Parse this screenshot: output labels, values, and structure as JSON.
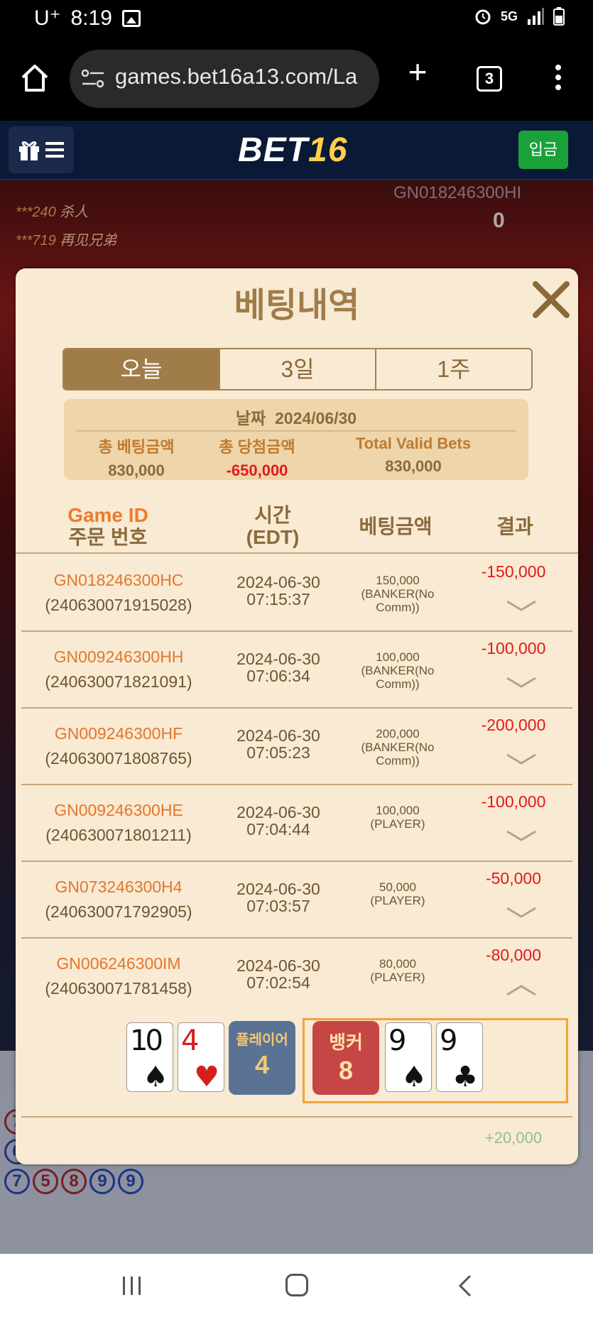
{
  "status_bar": {
    "carrier": "U⁺",
    "time": "8:19",
    "network": "5G"
  },
  "browser": {
    "url": "games.bet16a13.com/La",
    "tab_count": "3"
  },
  "site": {
    "logo_text": "BET",
    "logo_num": "16",
    "deposit_label": "입금"
  },
  "background": {
    "chat": [
      {
        "user": "***240",
        "msg": "杀人"
      },
      {
        "user": "***719",
        "msg": "再见兄弟"
      }
    ],
    "game_id": "GN018246300HI",
    "balance": "0"
  },
  "modal": {
    "title": "베팅내역",
    "tabs": [
      "오늘",
      "3일",
      "1주"
    ],
    "active_tab": 0,
    "summary": {
      "date_label": "날짜",
      "date": "2024/06/30",
      "total_bet_label": "총 베팅금액",
      "total_bet": "830,000",
      "total_win_label": "총 당첨금액",
      "total_win": "-650,000",
      "valid_label": "Total Valid Bets",
      "valid": "830,000"
    },
    "headers": {
      "game_id": "Game ID",
      "order_no": "주문 번호",
      "time": "시간",
      "time_zone": "(EDT)",
      "amount": "베팅금액",
      "result": "결과"
    },
    "rows": [
      {
        "game_id": "GN018246300HC",
        "order_no": "(240630071915028)",
        "date": "2024-06-30",
        "time": "07:15:37",
        "amount": "150,000",
        "bet_type": "(BANKER(No Comm))",
        "result": "-150,000"
      },
      {
        "game_id": "GN009246300HH",
        "order_no": "(240630071821091)",
        "date": "2024-06-30",
        "time": "07:06:34",
        "amount": "100,000",
        "bet_type": "(BANKER(No Comm))",
        "result": "-100,000"
      },
      {
        "game_id": "GN009246300HF",
        "order_no": "(240630071808765)",
        "date": "2024-06-30",
        "time": "07:05:23",
        "amount": "200,000",
        "bet_type": "(BANKER(No Comm))",
        "result": "-200,000"
      },
      {
        "game_id": "GN009246300HE",
        "order_no": "(240630071801211)",
        "date": "2024-06-30",
        "time": "07:04:44",
        "amount": "100,000",
        "bet_type": "(PLAYER)",
        "result": "-100,000"
      },
      {
        "game_id": "GN073246300H4",
        "order_no": "(240630071792905)",
        "date": "2024-06-30",
        "time": "07:03:57",
        "amount": "50,000",
        "bet_type": "(PLAYER)",
        "result": "-50,000"
      },
      {
        "game_id": "GN006246300IM",
        "order_no": "(240630071781458)",
        "date": "2024-06-30",
        "time": "07:02:54",
        "amount": "80,000",
        "bet_type": "(PLAYER)",
        "result": "-80,000"
      }
    ],
    "detail": {
      "player_cards": [
        {
          "rank": "10",
          "suit": "♠",
          "color": "black"
        },
        {
          "rank": "4",
          "suit": "♥",
          "color": "red"
        }
      ],
      "player_label": "플레이어",
      "player_score": "4",
      "banker_label": "뱅커",
      "banker_score": "8",
      "banker_cards": [
        {
          "rank": "9",
          "suit": "♠",
          "color": "black"
        },
        {
          "rank": "9",
          "suit": "♣",
          "color": "black"
        }
      ]
    },
    "next_row_result": "+20,000"
  },
  "colors": {
    "modal_bg": "#f8ead3",
    "accent": "#a07c48",
    "negative": "#e21a1a",
    "game_id": "#e3772c",
    "deposit": "#1aa23a"
  }
}
